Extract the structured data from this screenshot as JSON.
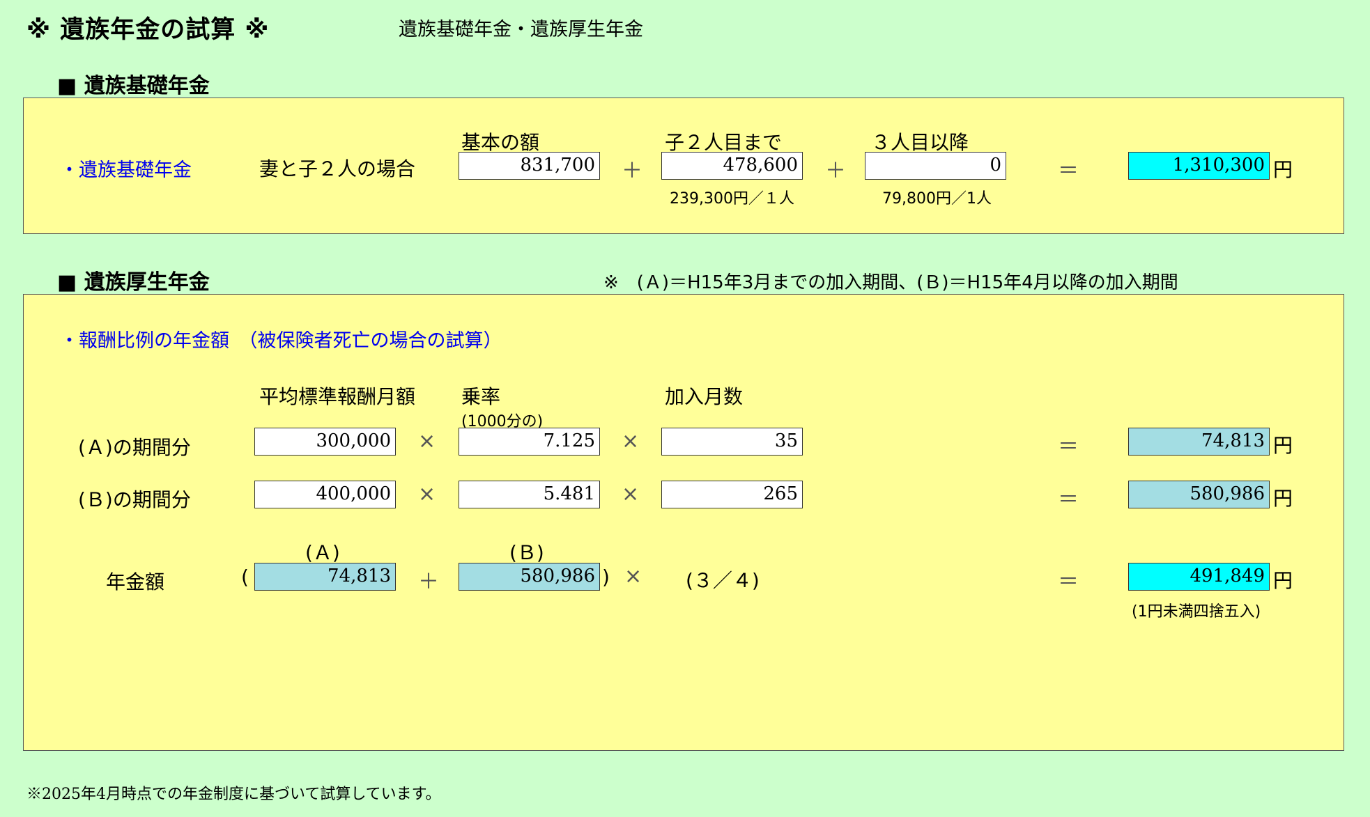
{
  "header": {
    "title": "※ 遺族年金の試算 ※",
    "subtitle": "遺族基礎年金・遺族厚生年金"
  },
  "kiso": {
    "heading": "■ 遺族基礎年金",
    "row_label": "・遺族基礎年金",
    "case_label": "妻と子２人の場合",
    "col_base": "基本の額",
    "col_child2": "子２人目まで",
    "col_child3": "３人目以降",
    "base_value": "831,700",
    "child2_value": "478,600",
    "child3_value": "0",
    "child2_note": "239,300円／１人",
    "child3_note": "79,800円／1人",
    "total_value": "1,310,300",
    "plus": "＋",
    "equals": "＝",
    "yen": "円"
  },
  "kosei": {
    "heading": "■ 遺族厚生年金",
    "note": "※　(Ａ)＝H15年3月までの加入期間、(Ｂ)＝H15年4月以降の加入期間",
    "section_label": "・報酬比例の年金額　（被保険者死亡の場合の試算）",
    "col_avg": "平均標準報酬月額",
    "col_rate": "乗率",
    "col_rate_sub": "(1000分の)",
    "col_months": "加入月数",
    "row_a_label": "(Ａ)の期間分",
    "row_b_label": "(Ｂ)の期間分",
    "a_avg": "300,000",
    "a_rate": "7.125",
    "a_months": "35",
    "a_result": "74,813",
    "b_avg": "400,000",
    "b_rate": "5.481",
    "b_months": "265",
    "b_result": "580,986",
    "sum_label": "年金額",
    "sum_a_hdr": "(Ａ)",
    "sum_b_hdr": "(Ｂ)",
    "sum_a": "74,813",
    "sum_b": "580,986",
    "open_paren": "(",
    "close_paren": ")",
    "fraction": "(３／４)",
    "total": "491,849",
    "rounding_note": "(1円未満四捨五入)",
    "times": "×",
    "plus": "＋",
    "equals": "＝",
    "yen": "円"
  },
  "footer": {
    "note": "※2025年4月時点での年金制度に基づいて試算しています。"
  },
  "colors": {
    "background": "#ccffcc",
    "panel": "#ffff99",
    "result_cyan": "#00ffff",
    "result_teal": "#a3dde3",
    "label_blue": "#0000ee"
  }
}
